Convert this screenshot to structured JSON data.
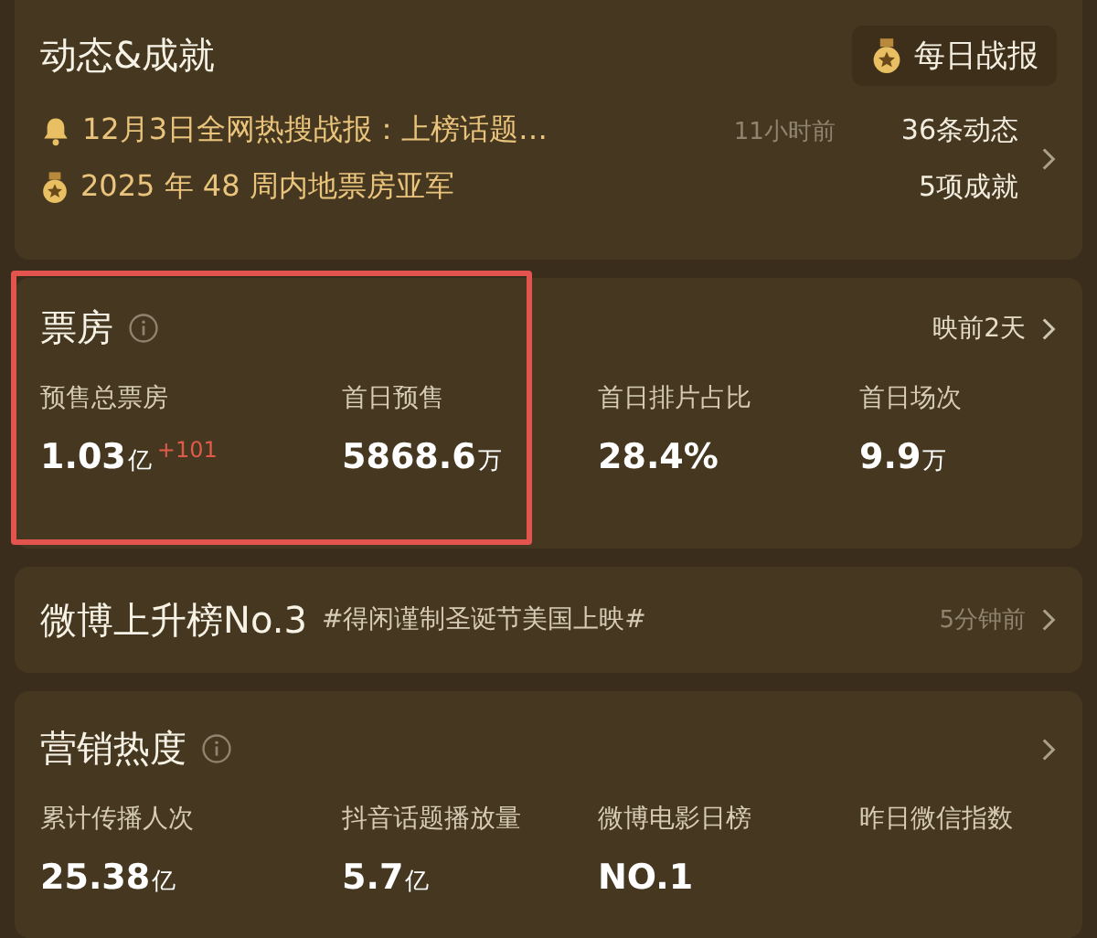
{
  "news": {
    "title": "动态&成就",
    "report_button": "每日战报",
    "rows": [
      {
        "kind": "bell",
        "text": "12月3日全网热搜战报：上榜话题…",
        "time": "11小时前",
        "count": "36条动态"
      },
      {
        "kind": "medal",
        "text": "2025 年 48 周内地票房亚军",
        "count": "5项成就"
      }
    ]
  },
  "box_office": {
    "title": "票房",
    "highlighted": true,
    "link": "映前2天",
    "metrics": [
      {
        "label": "预售总票房",
        "value": "1.03",
        "unit": "亿",
        "delta": "+101"
      },
      {
        "label": "首日预售",
        "value": "5868.6",
        "unit": "万"
      },
      {
        "label": "首日排片占比",
        "value": "28.4%"
      },
      {
        "label": "首日场次",
        "value": "9.9",
        "unit": "万"
      }
    ]
  },
  "weibo": {
    "title": "微博上升榜No.3",
    "topic": "#得闲谨制圣诞节美国上映#",
    "time": "5分钟前"
  },
  "marketing": {
    "title": "营销热度",
    "metrics": [
      {
        "label": "累计传播人次",
        "value": "25.38",
        "unit": "亿"
      },
      {
        "label": "抖音话题播放量",
        "value": "5.7",
        "unit": "亿"
      },
      {
        "label": "微博电影日榜",
        "value": "NO.1"
      },
      {
        "label": "昨日微信指数"
      }
    ]
  }
}
